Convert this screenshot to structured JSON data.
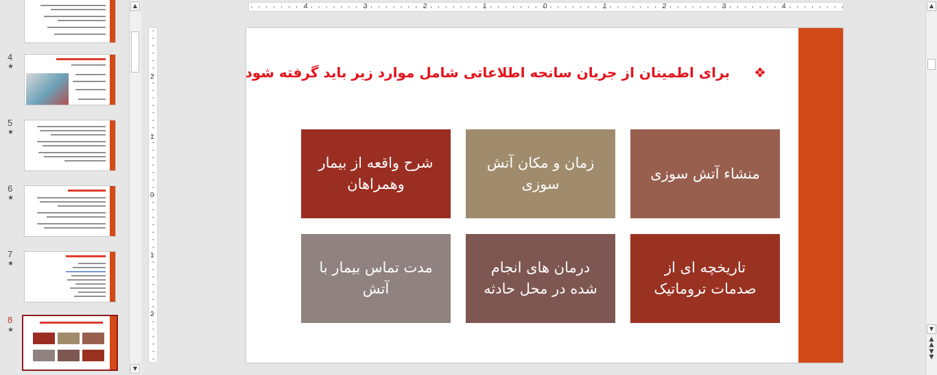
{
  "thumbnails": [
    {
      "number": "4",
      "star": "★"
    },
    {
      "number": "5",
      "star": "★"
    },
    {
      "number": "6",
      "star": "★"
    },
    {
      "number": "7",
      "star": "★"
    },
    {
      "number": "8",
      "star": "★"
    }
  ],
  "ruler": {
    "horizontal_labels": [
      "4",
      "3",
      "2",
      "1",
      "0",
      "1",
      "2",
      "3",
      "4"
    ],
    "vertical_labels": [
      "2",
      "1",
      "0",
      "1",
      "2"
    ]
  },
  "slide": {
    "bullet": "❖",
    "title": "برای اطمینان از جریان سانحه اطلاعاتی شامل موارد زیر باید گرفته شود:",
    "boxes": [
      {
        "text": "منشاء آتش سوزی",
        "color": "#985f4f"
      },
      {
        "text": "زمان و مکان آتش سوزی",
        "color": "#a08c6c"
      },
      {
        "text": "شرح واقعه از بیمار وهمراهان",
        "color": "#9b2e22"
      },
      {
        "text": "تاریخچه ای از صدمات تروماتیک",
        "color": "#9a3222"
      },
      {
        "text": "درمان های انجام شده در محل حادثه",
        "color": "#7e5652"
      },
      {
        "text": "مدت تماس بیمار با آتش",
        "color": "#8f8280"
      }
    ],
    "accent_bar_color": "#d24a18",
    "title_color": "#e3141c"
  }
}
